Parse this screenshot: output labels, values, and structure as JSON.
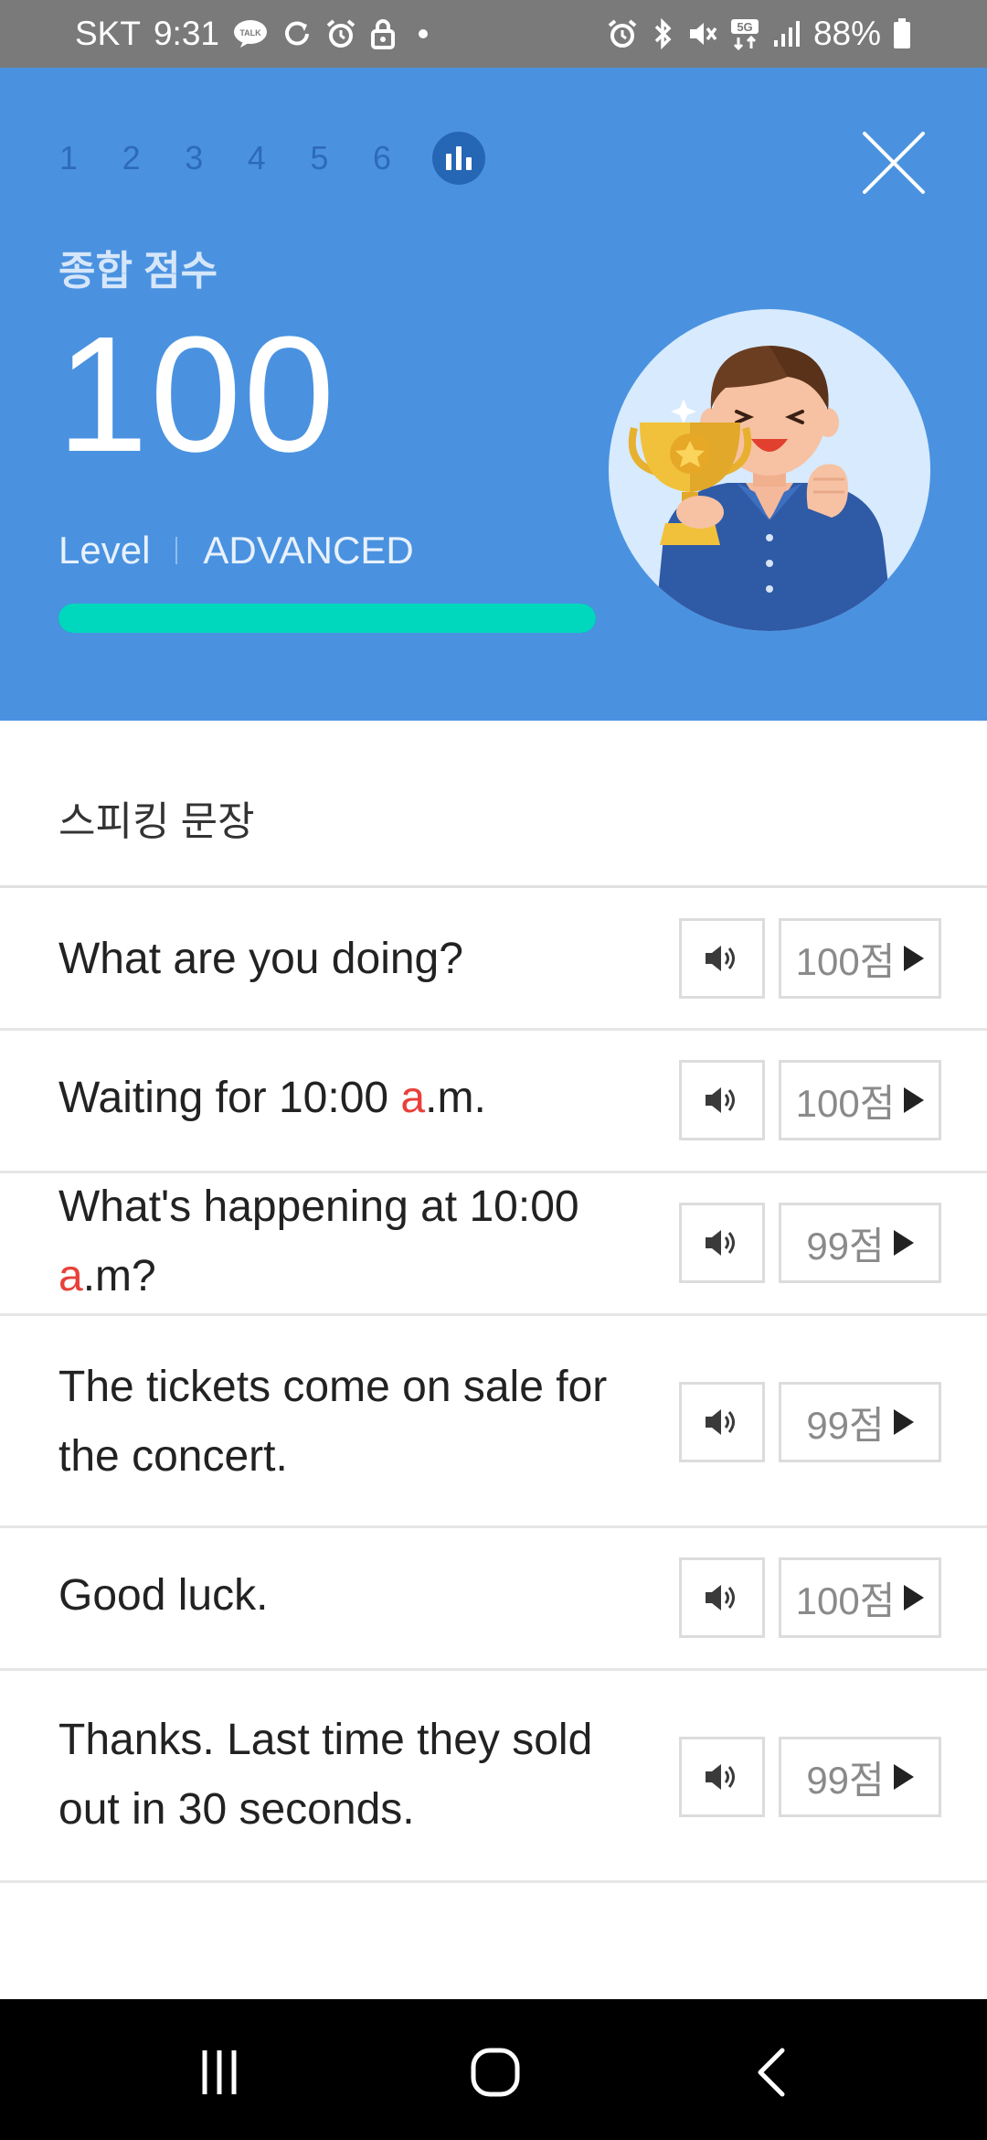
{
  "status_bar": {
    "carrier": "SKT",
    "time": "9:31",
    "battery": "88%",
    "network": "5G",
    "left_icons": [
      "talk-icon",
      "sync-icon",
      "alarm-icon",
      "lock-icon",
      "dot-icon"
    ],
    "right_icons": [
      "alarm-icon",
      "bluetooth-icon",
      "mute-icon",
      "5g-icon",
      "signal-icon",
      "battery-icon"
    ]
  },
  "header": {
    "steps": [
      "1",
      "2",
      "3",
      "4",
      "5",
      "6"
    ],
    "active_step_icon": "bar-chart-icon",
    "score_title": "종합 점수",
    "score": "100",
    "level_label": "Level",
    "level_value": "ADVANCED",
    "progress_percent": 100,
    "close_icon": "close-icon",
    "avatar_icon": "trophy-character-illustration"
  },
  "section": {
    "title": "스피킹 문장"
  },
  "sentences": [
    {
      "parts": [
        {
          "text": "What are you doing?",
          "hl": false
        }
      ],
      "score": "100점"
    },
    {
      "parts": [
        {
          "text": "Waiting for 10:00 ",
          "hl": false
        },
        {
          "text": "a",
          "hl": true
        },
        {
          "text": ".m.",
          "hl": false
        }
      ],
      "score": "100점"
    },
    {
      "parts": [
        {
          "text": "What's happening at 10:00 ",
          "hl": false
        },
        {
          "text": "a",
          "hl": true
        },
        {
          "text": ".m?",
          "hl": false
        }
      ],
      "score": "99점"
    },
    {
      "parts": [
        {
          "text": "The tickets come on sale for the concert.",
          "hl": false
        }
      ],
      "score": "99점"
    },
    {
      "parts": [
        {
          "text": "Good luck.",
          "hl": false
        }
      ],
      "score": "100점"
    },
    {
      "parts": [
        {
          "text": "Thanks. Last time they sold out in 30 seconds.",
          "hl": false
        }
      ],
      "score": "99점"
    }
  ],
  "nav_bar": {
    "icons": [
      "recents-icon",
      "home-icon",
      "back-icon"
    ]
  },
  "colors": {
    "header_bg": "#4a92e0",
    "progress": "#00d8bd",
    "highlight": "#e8403a"
  }
}
